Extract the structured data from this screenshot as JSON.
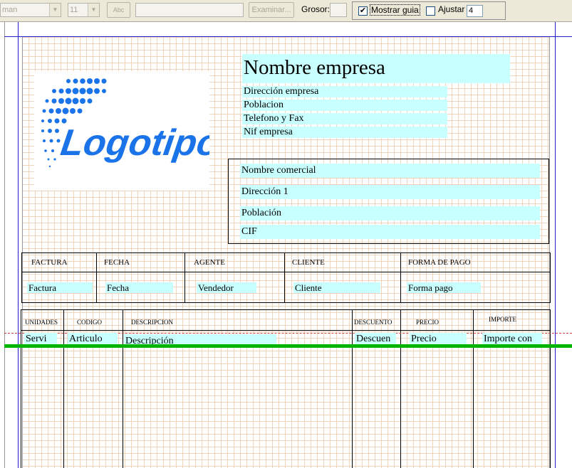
{
  "toolbar": {
    "font_name": "man",
    "font_size": "11",
    "abc_label": "Abc",
    "examinar_label": "Examinar...",
    "grosor_label": "Grosor:",
    "mostrar_guia_label": "Mostrar guia",
    "mostrar_guia_checked": "✔",
    "ajustar_label": "Ajustar",
    "ajustar_value": "4"
  },
  "company": {
    "name": "Nombre empresa",
    "address": "Dirección empresa",
    "city": "Poblacion",
    "phone_fax": "Telefono y Fax",
    "nif": "Nif empresa"
  },
  "logo": {
    "text": "Logotipo",
    "color": "#1a73e8"
  },
  "client": {
    "commercial_name": "Nombre comercial",
    "address": "Dirección 1",
    "city": "Población",
    "cif": "CIF"
  },
  "invoice_header": {
    "columns": [
      "FACTURA",
      "FECHA",
      "AGENTE",
      "CLIENTE",
      "FORMA DE PAGO"
    ],
    "values": [
      "Factura",
      "Fecha",
      "Vendedor",
      "Cliente",
      "Forma pago"
    ]
  },
  "lines": {
    "columns": [
      "UNIDADES",
      "CODIGO",
      "DESCRIPCION",
      "DESCUENTO",
      "PRECIO",
      "IMPORTE"
    ],
    "values": [
      "Servi",
      "Articulo",
      "Descripción",
      "Descuen",
      "Precio",
      "Importe con"
    ]
  },
  "colors": {
    "field_bg": "#c8ffff",
    "guide_blue": "#1f1fd0",
    "band_green": "#00b400",
    "grid_orange": "#e8bc96"
  }
}
